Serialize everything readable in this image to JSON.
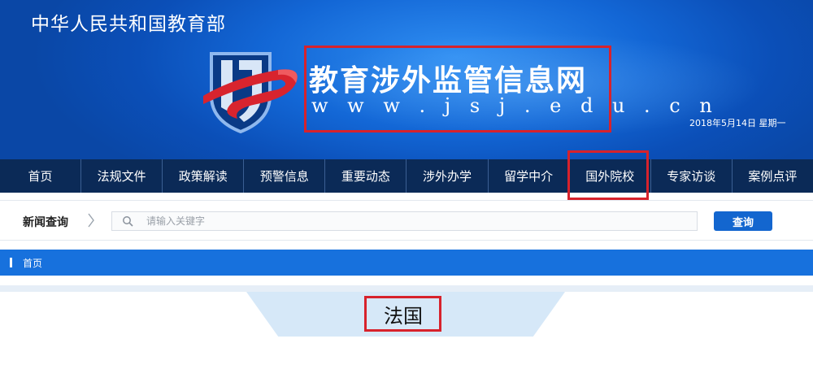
{
  "header": {
    "ministry_name": "中华人民共和国教育部",
    "site_title": "教育涉外监管信息网",
    "site_url": "w w w . j s j . e d u . c n",
    "date": "2018年5月14日  星期一",
    "logo_icon": "jsj-shield-logo-icon"
  },
  "nav": {
    "items": [
      "首页",
      "法规文件",
      "政策解读",
      "预警信息",
      "重要动态",
      "涉外办学",
      "留学中介",
      "国外院校",
      "专家访谈",
      "案例点评"
    ]
  },
  "search": {
    "label": "新闻查询",
    "placeholder": "请输入关键字",
    "button_label": "查询"
  },
  "breadcrumb": {
    "home": "首页"
  },
  "content": {
    "country": "法国"
  },
  "colors": {
    "banner_blue": "#1367d6",
    "nav_navy": "#0b2a57",
    "crumb_blue": "#1771dd",
    "highlight_red": "#d7222c"
  }
}
